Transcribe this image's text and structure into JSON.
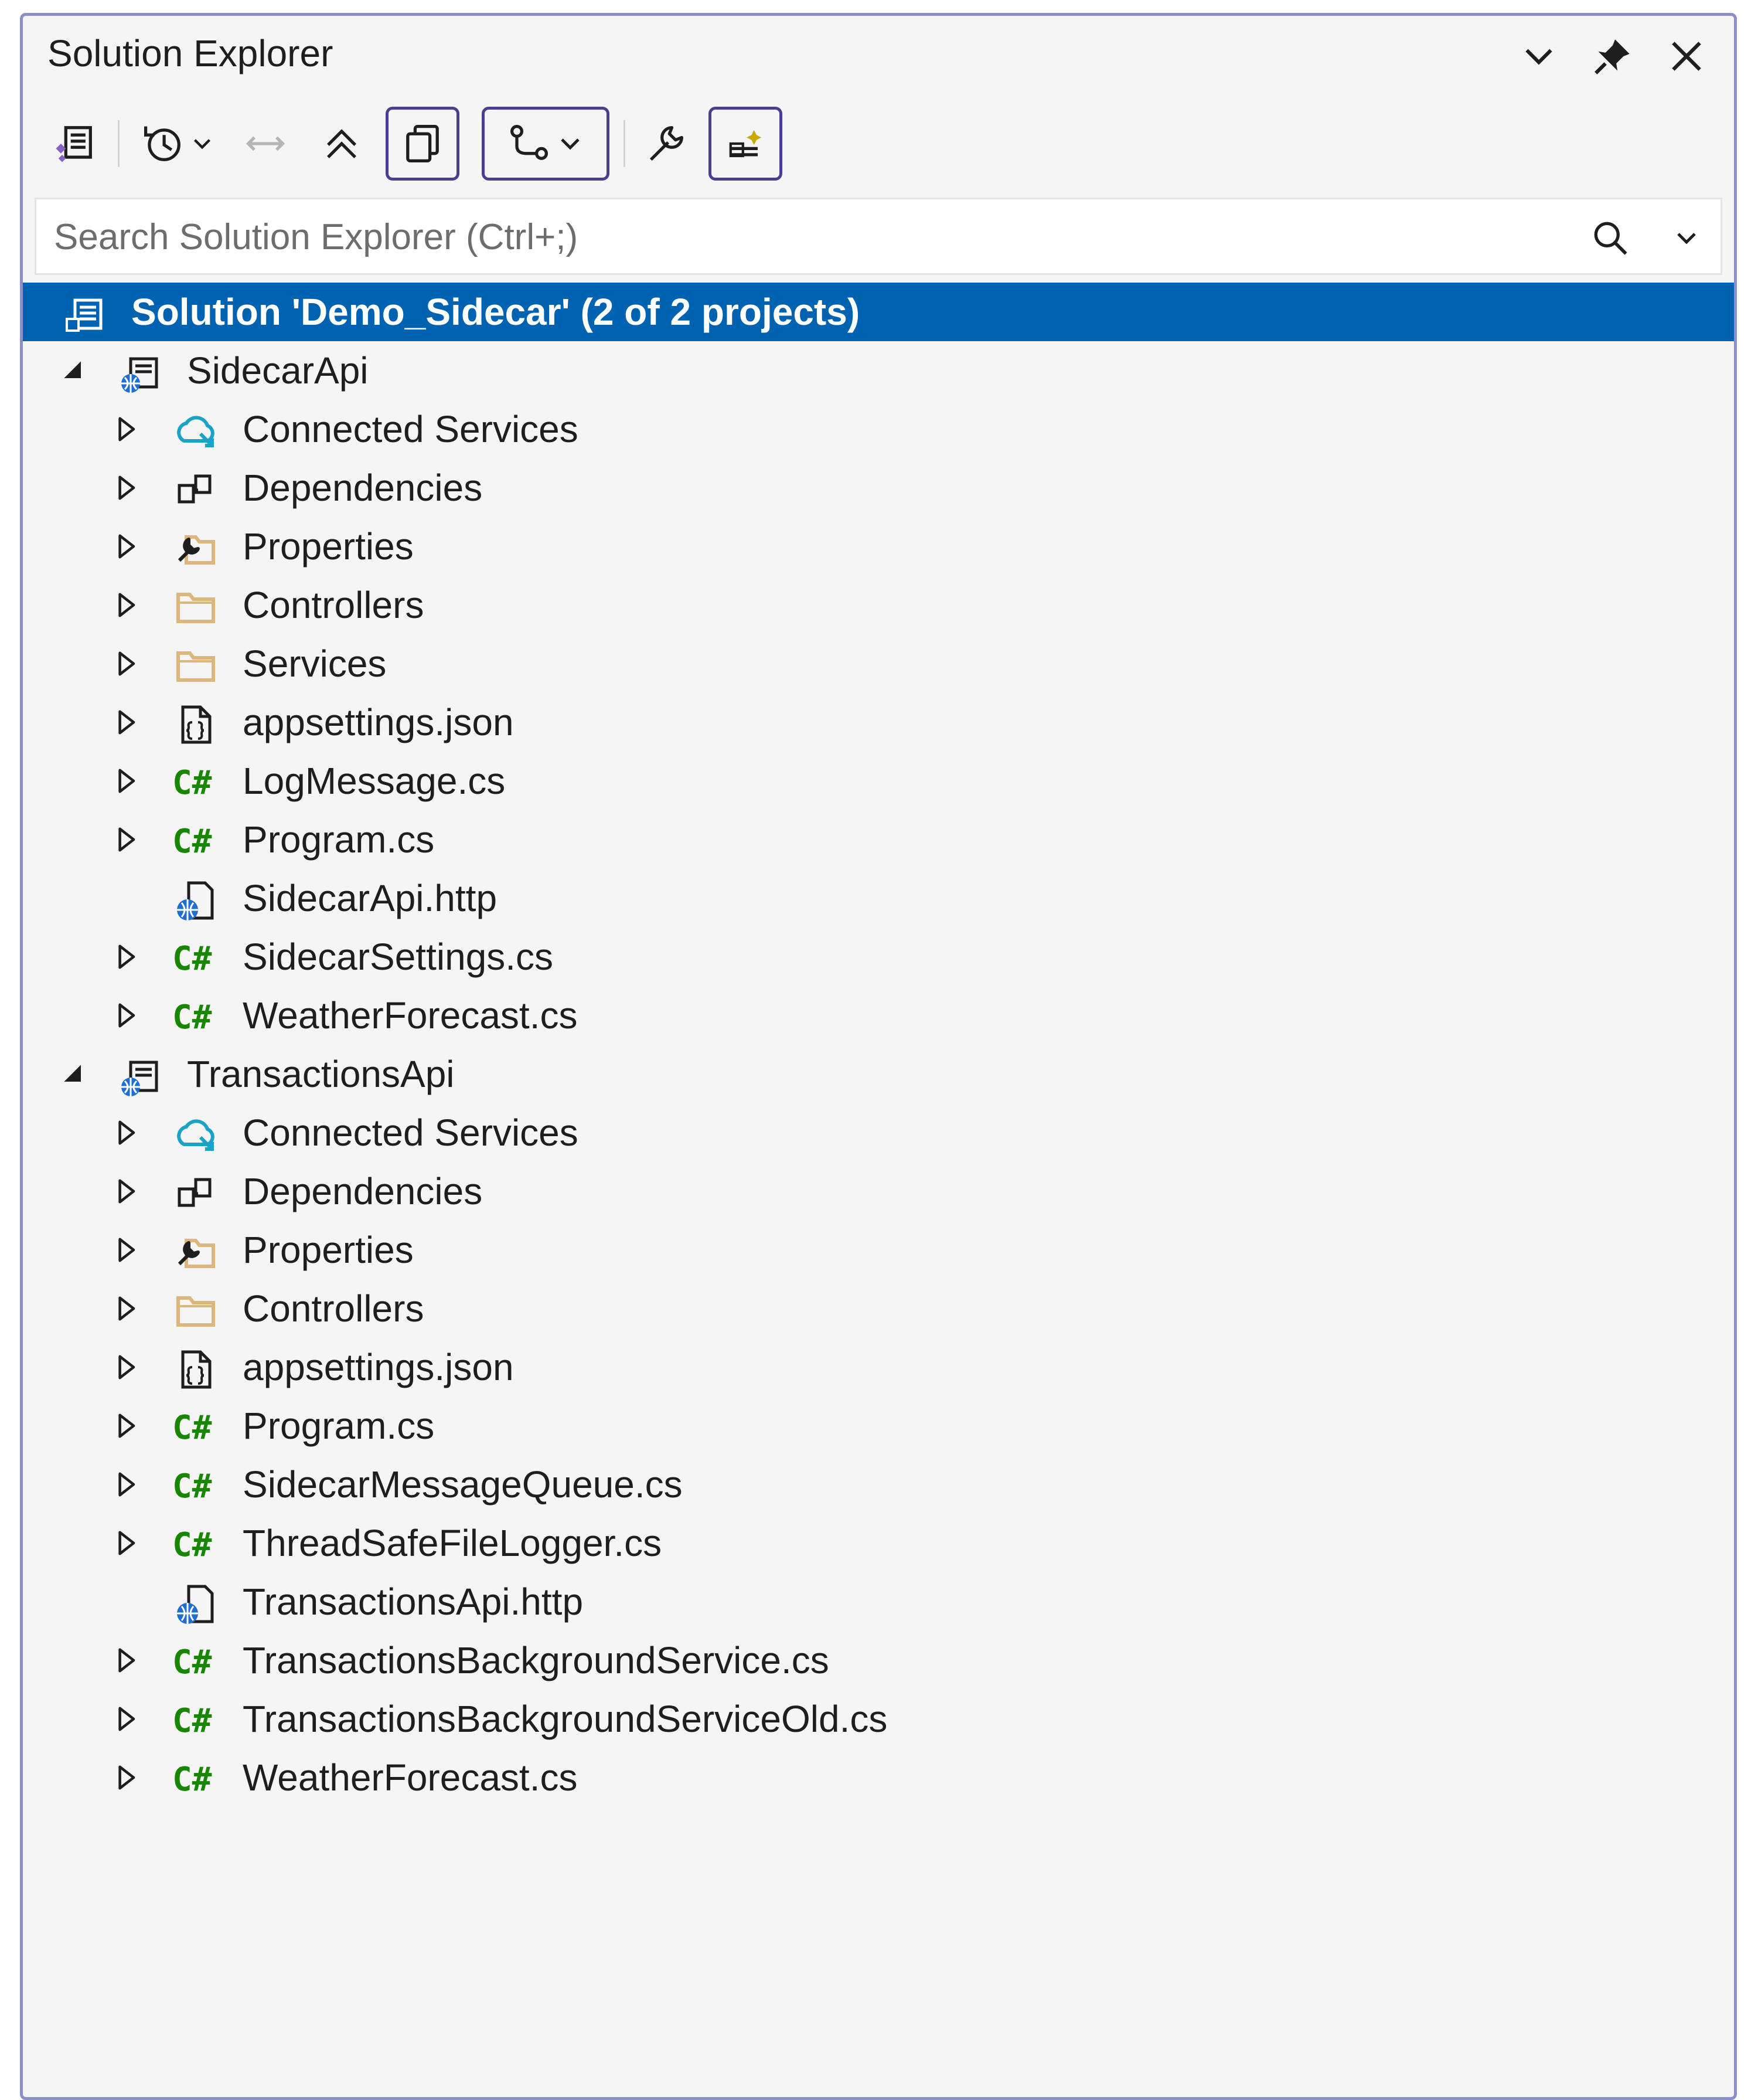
{
  "window": {
    "title": "Solution Explorer",
    "icons": [
      "dropdown-chevron-icon",
      "pin-icon",
      "close-icon"
    ]
  },
  "toolbar": {
    "items": [
      "switch-views-icon",
      "history-icon",
      "back-forward-icon",
      "collapse-all-icon",
      "show-all-files-icon",
      "git-branch-filter-icon",
      "properties-wrench-icon",
      "preview-selected-icon"
    ]
  },
  "search": {
    "placeholder": "Search Solution Explorer (Ctrl+;)"
  },
  "colors": {
    "selection": "#0063b1",
    "csharp": "#178600",
    "folder": "#dcb67a",
    "panel_border": "#8a8fc9"
  },
  "tree": {
    "solution": "Solution 'Demo_Sidecar' (2 of 2 projects)",
    "projects": [
      {
        "name": "SidecarApi",
        "items": [
          {
            "label": "Connected Services",
            "icon": "connected-services-icon",
            "expandable": true
          },
          {
            "label": "Dependencies",
            "icon": "dependencies-icon",
            "expandable": true
          },
          {
            "label": "Properties",
            "icon": "properties-folder-icon",
            "expandable": true
          },
          {
            "label": "Controllers",
            "icon": "folder-icon",
            "expandable": true
          },
          {
            "label": "Services",
            "icon": "folder-icon",
            "expandable": true
          },
          {
            "label": "appsettings.json",
            "icon": "json-file-icon",
            "expandable": true
          },
          {
            "label": "LogMessage.cs",
            "icon": "csharp-icon",
            "expandable": true
          },
          {
            "label": "Program.cs",
            "icon": "csharp-icon",
            "expandable": true
          },
          {
            "label": "SidecarApi.http",
            "icon": "http-file-icon",
            "expandable": false
          },
          {
            "label": "SidecarSettings.cs",
            "icon": "csharp-icon",
            "expandable": true
          },
          {
            "label": "WeatherForecast.cs",
            "icon": "csharp-icon",
            "expandable": true
          }
        ]
      },
      {
        "name": "TransactionsApi",
        "items": [
          {
            "label": "Connected Services",
            "icon": "connected-services-icon",
            "expandable": true
          },
          {
            "label": "Dependencies",
            "icon": "dependencies-icon",
            "expandable": true
          },
          {
            "label": "Properties",
            "icon": "properties-folder-icon",
            "expandable": true
          },
          {
            "label": "Controllers",
            "icon": "folder-icon",
            "expandable": true
          },
          {
            "label": "appsettings.json",
            "icon": "json-file-icon",
            "expandable": true
          },
          {
            "label": "Program.cs",
            "icon": "csharp-icon",
            "expandable": true
          },
          {
            "label": "SidecarMessageQueue.cs",
            "icon": "csharp-icon",
            "expandable": true
          },
          {
            "label": "ThreadSafeFileLogger.cs",
            "icon": "csharp-icon",
            "expandable": true
          },
          {
            "label": "TransactionsApi.http",
            "icon": "http-file-icon",
            "expandable": false
          },
          {
            "label": "TransactionsBackgroundService.cs",
            "icon": "csharp-icon",
            "expandable": true
          },
          {
            "label": "TransactionsBackgroundServiceOld.cs",
            "icon": "csharp-icon",
            "expandable": true
          },
          {
            "label": "WeatherForecast.cs",
            "icon": "csharp-icon",
            "expandable": true
          }
        ]
      }
    ]
  }
}
